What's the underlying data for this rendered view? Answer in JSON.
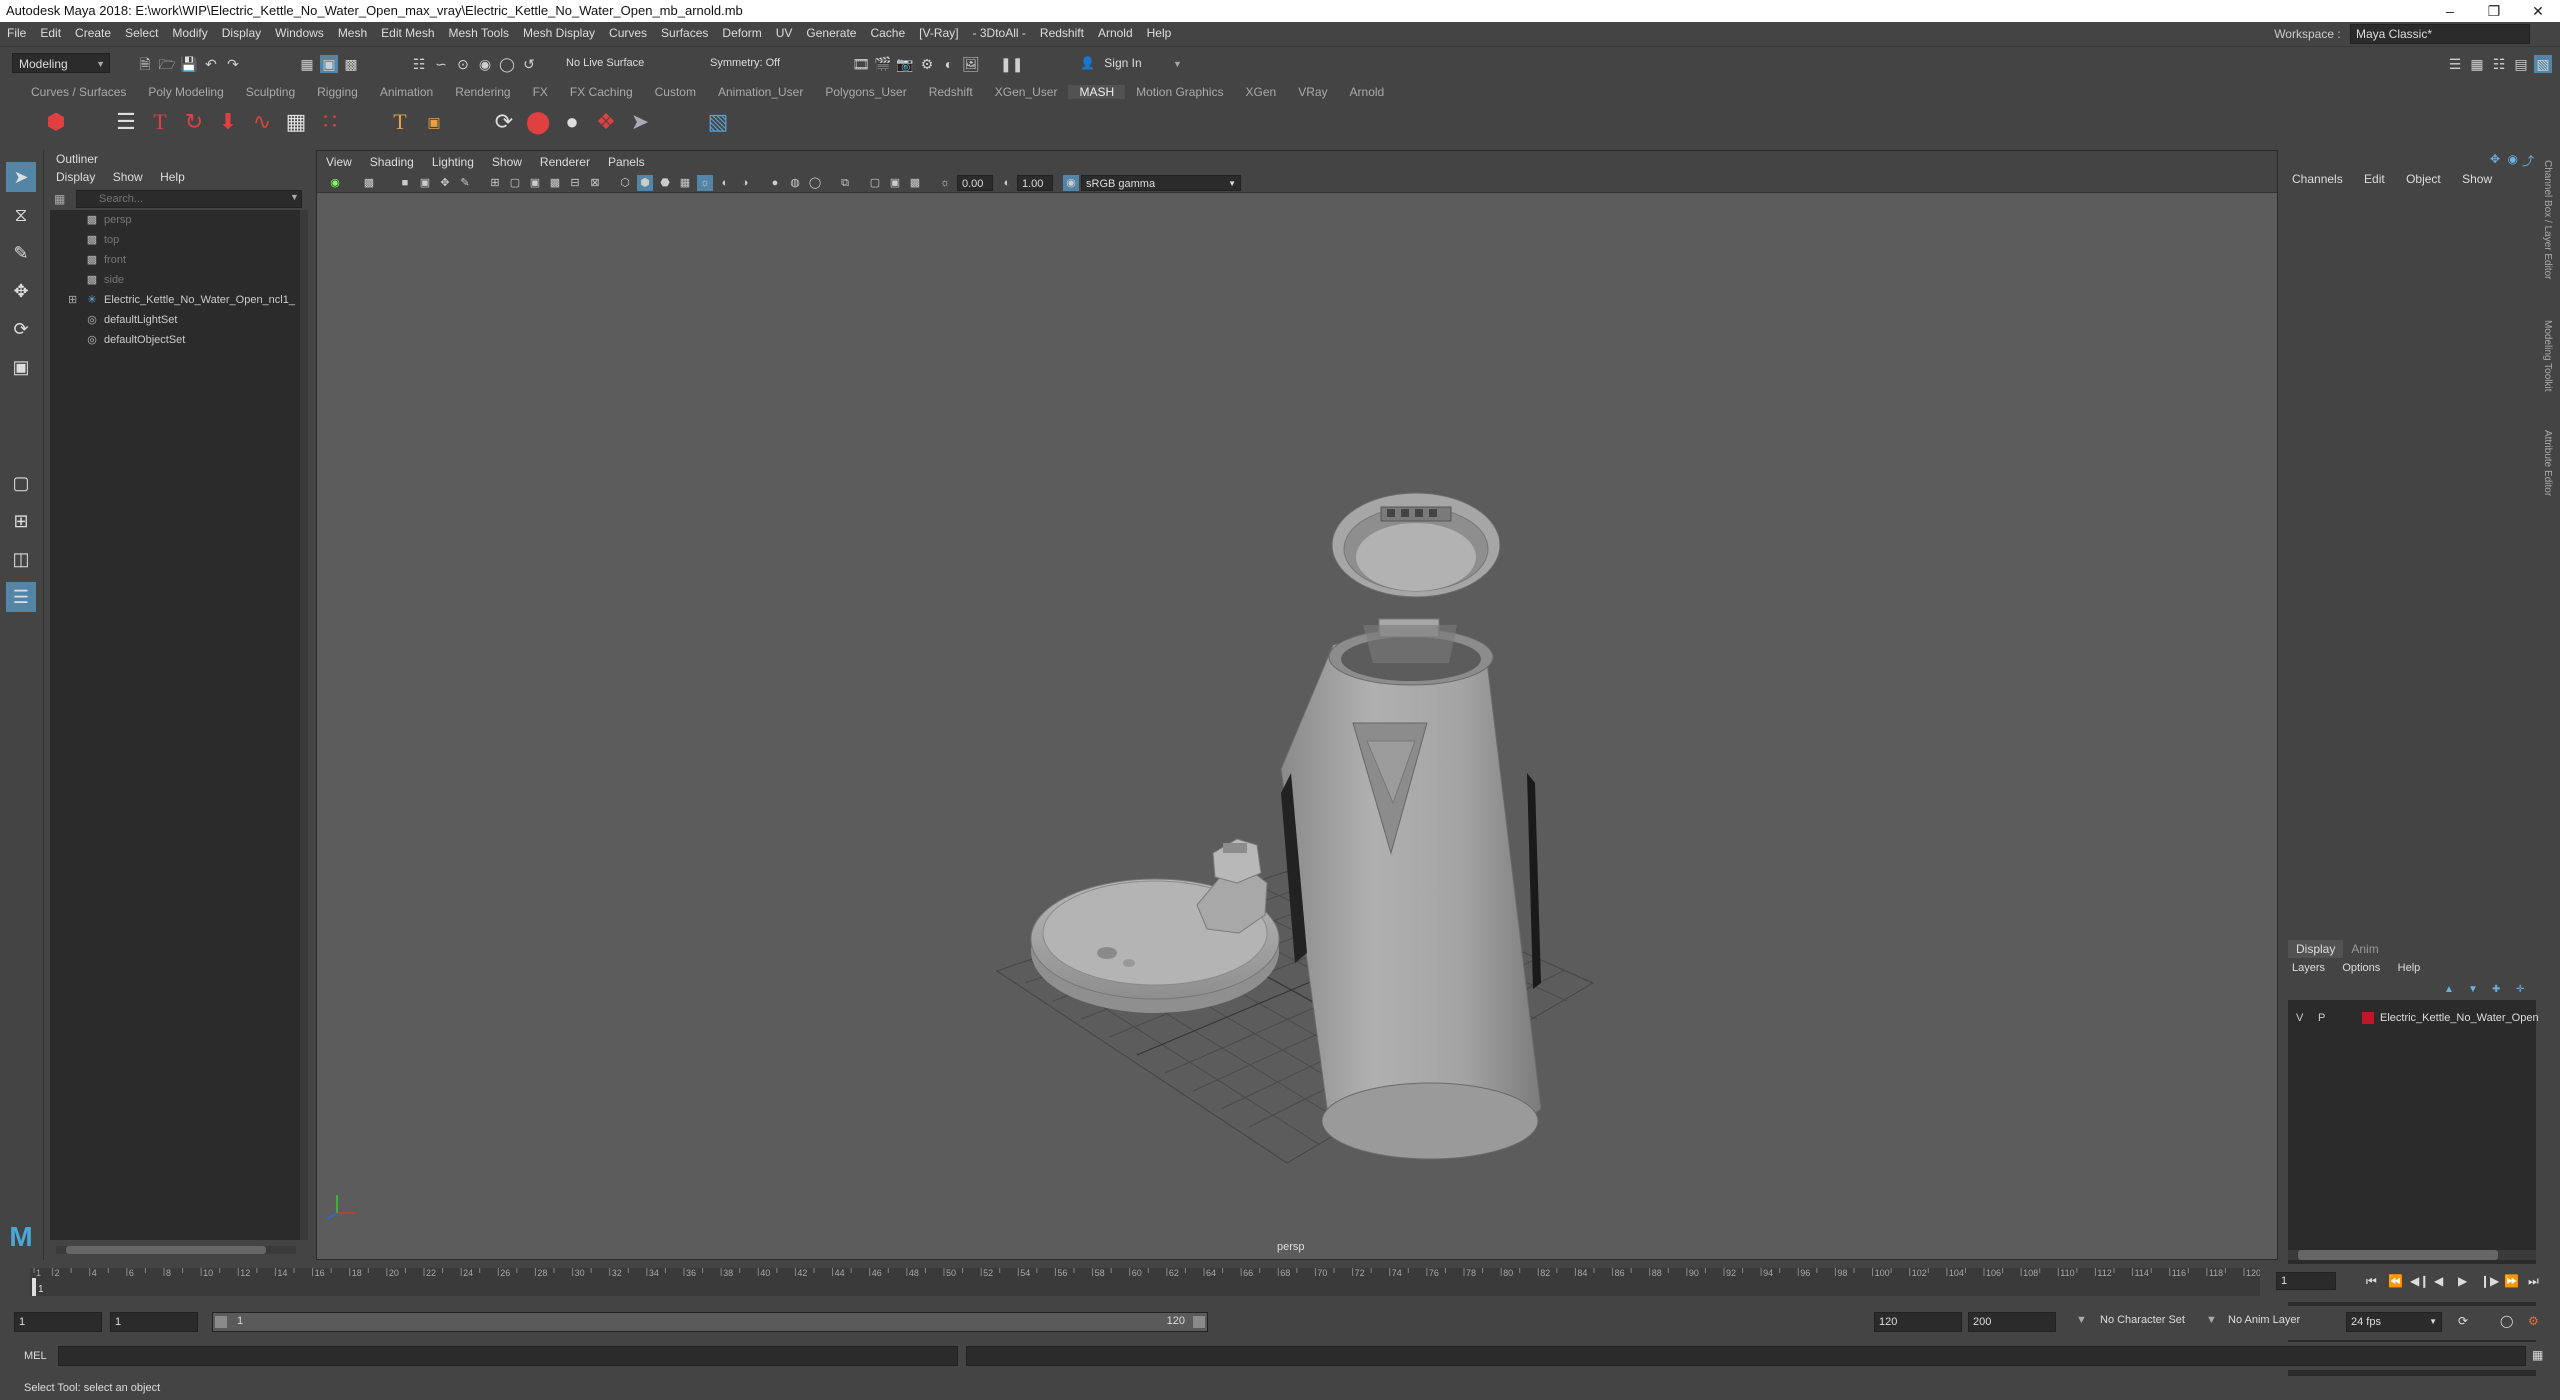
{
  "window": {
    "title": "Autodesk Maya 2018: E:\\work\\WIP\\Electric_Kettle_No_Water_Open_max_vray\\Electric_Kettle_No_Water_Open_mb_arnold.mb"
  },
  "menubar": {
    "items": [
      "File",
      "Edit",
      "Create",
      "Select",
      "Modify",
      "Display",
      "Windows",
      "Mesh",
      "Edit Mesh",
      "Mesh Tools",
      "Mesh Display",
      "Curves",
      "Surfaces",
      "Deform",
      "UV",
      "Generate",
      "Cache",
      "V-Ray",
      "3DtoAll",
      "Redshift",
      "Arnold",
      "Help"
    ],
    "workspace_label": "Workspace :",
    "workspace_value": "Maya Classic*"
  },
  "statusline": {
    "mode": "Modeling",
    "live_surface": "No Live Surface",
    "symmetry": "Symmetry: Off",
    "sign_in": "Sign In"
  },
  "shelf": {
    "tabs": [
      "Curves / Surfaces",
      "Poly Modeling",
      "Sculpting",
      "Rigging",
      "Animation",
      "Rendering",
      "FX",
      "FX Caching",
      "Custom",
      "Animation_User",
      "Polygons_User",
      "Redshift",
      "XGen_User",
      "MASH",
      "Motion Graphics",
      "XGen",
      "VRay",
      "Arnold"
    ],
    "active_tab": "MASH"
  },
  "outliner": {
    "title": "Outliner",
    "menu": [
      "Display",
      "Show",
      "Help"
    ],
    "search_placeholder": "Search...",
    "nodes": [
      {
        "label": "persp",
        "icon": "camera-icon",
        "dim": true
      },
      {
        "label": "top",
        "icon": "camera-icon",
        "dim": true
      },
      {
        "label": "front",
        "icon": "camera-icon",
        "dim": true
      },
      {
        "label": "side",
        "icon": "camera-icon",
        "dim": true
      },
      {
        "label": "Electric_Kettle_No_Water_Open_ncl1_",
        "icon": "group-icon",
        "dim": false
      },
      {
        "label": "defaultLightSet",
        "icon": "set-icon",
        "dim": false
      },
      {
        "label": "defaultObjectSet",
        "icon": "set-icon",
        "dim": false
      }
    ]
  },
  "viewport": {
    "menu": [
      "View",
      "Shading",
      "Lighting",
      "Show",
      "Renderer",
      "Panels"
    ],
    "exposure": "0.00",
    "gamma": "1.00",
    "color_space": "sRGB gamma",
    "camera_label": "persp"
  },
  "channelbox": {
    "menu": [
      "Channels",
      "Edit",
      "Object",
      "Show"
    ],
    "layer_tabs": [
      "Display",
      "Anim"
    ],
    "layer_menu": [
      "Layers",
      "Options",
      "Help"
    ],
    "layer": {
      "v": "V",
      "p": "P",
      "name": "Electric_Kettle_No_Water_Open",
      "color": "#c0162a"
    }
  },
  "sidetabs": [
    "Channel Box / Layer Editor",
    "Modeling Toolkit",
    "Attribute Editor"
  ],
  "timeline": {
    "ticks": [
      "1",
      "2",
      "4",
      "6",
      "8",
      "10",
      "12",
      "14",
      "16",
      "18",
      "20",
      "22",
      "24",
      "26",
      "28",
      "30",
      "32",
      "34",
      "36",
      "38",
      "40",
      "42",
      "44",
      "46",
      "48",
      "50",
      "52",
      "54",
      "56",
      "58",
      "60",
      "62",
      "64",
      "66",
      "68",
      "70",
      "72",
      "74",
      "76",
      "78",
      "80",
      "82",
      "84",
      "86",
      "88",
      "90",
      "92",
      "94",
      "96",
      "98",
      "100",
      "102",
      "104",
      "106",
      "108",
      "110",
      "112",
      "114",
      "116",
      "118",
      "120"
    ],
    "current_frame": "1"
  },
  "range": {
    "start": "1",
    "playback_start": "1",
    "slider_start": "1",
    "slider_end": "120",
    "playback_end": "120",
    "end": "200",
    "character_set": "No Character Set",
    "anim_layer": "No Anim Layer",
    "fps": "24 fps"
  },
  "cmdline": {
    "lang": "MEL"
  },
  "helpline": {
    "text": "Select Tool: select an object"
  }
}
